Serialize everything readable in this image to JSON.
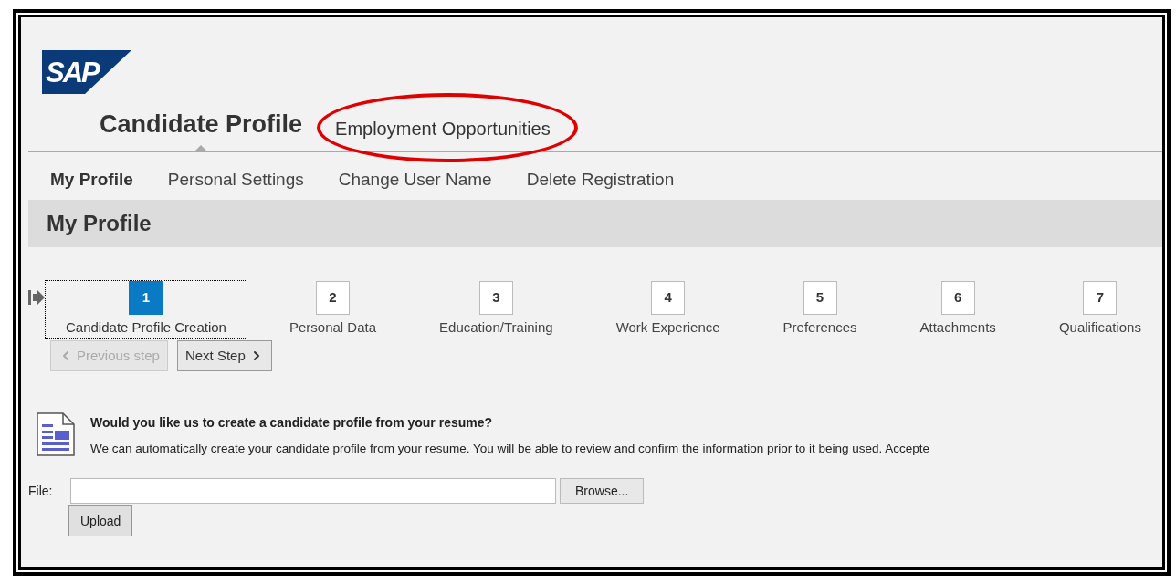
{
  "logo": {
    "text": "SAP"
  },
  "top_tabs": [
    {
      "label": "Candidate Profile",
      "selected": true,
      "circled": false
    },
    {
      "label": "Employment Opportunities",
      "selected": false,
      "circled": true
    }
  ],
  "sub_tabs": [
    {
      "label": "My Profile",
      "selected": true
    },
    {
      "label": "Personal Settings",
      "selected": false
    },
    {
      "label": "Change User Name",
      "selected": false
    },
    {
      "label": "Delete Registration",
      "selected": false
    }
  ],
  "page_title": "My Profile",
  "steps": [
    {
      "number": "1",
      "label": "Candidate Profile Creation",
      "selected": true
    },
    {
      "number": "2",
      "label": "Personal Data",
      "selected": false
    },
    {
      "number": "3",
      "label": "Education/Training",
      "selected": false
    },
    {
      "number": "4",
      "label": "Work Experience",
      "selected": false
    },
    {
      "number": "5",
      "label": "Preferences",
      "selected": false
    },
    {
      "number": "6",
      "label": "Attachments",
      "selected": false
    },
    {
      "number": "7",
      "label": "Qualifications",
      "selected": false
    }
  ],
  "nav_buttons": [
    {
      "label": "Previous step",
      "kind": "previous",
      "disabled": true
    },
    {
      "label": "Next Step",
      "kind": "next",
      "disabled": false
    }
  ],
  "resume": {
    "heading": "Would you like us to create a candidate profile from your resume?",
    "text": "We can automatically create your candidate profile from your resume. You will be able to review and confirm the information prior to it being used. Accepte",
    "file_label": "File:",
    "browse_button": "Browse...",
    "upload_button": "Upload"
  }
}
